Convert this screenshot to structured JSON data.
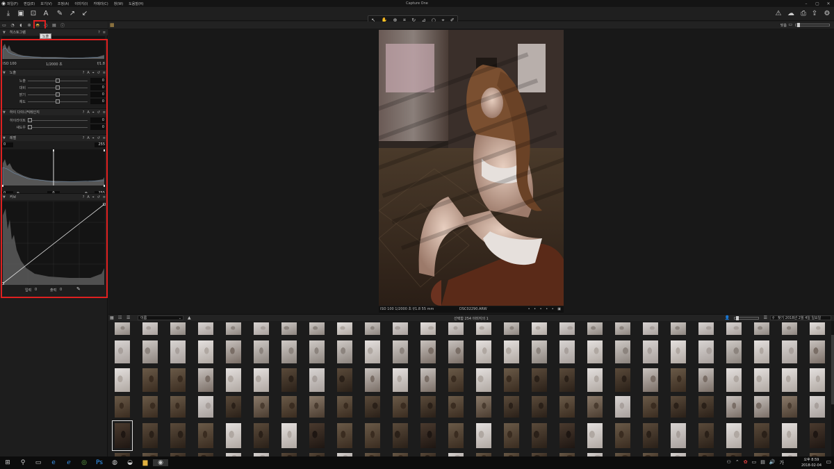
{
  "window": {
    "title": "Capture One"
  },
  "menu": [
    {
      "label": "파일(F)"
    },
    {
      "label": "편집(E)"
    },
    {
      "label": "보기(V)"
    },
    {
      "label": "조정(A)"
    },
    {
      "label": "이미지(I)"
    },
    {
      "label": "카메라(C)"
    },
    {
      "label": "창(W)"
    },
    {
      "label": "도움말(H)"
    }
  ],
  "left_tabs": {
    "tooltip": "노출"
  },
  "histogram": {
    "title": "히스토그램",
    "iso": "ISO 100",
    "shutter": "1/2000 초",
    "aperture": "f/1.8"
  },
  "exposure": {
    "title": "노출",
    "sliders": [
      {
        "label": "노출",
        "value": "0",
        "pos": 0.5
      },
      {
        "label": "대비",
        "value": "0",
        "pos": 0.5
      },
      {
        "label": "밝기",
        "value": "0",
        "pos": 0.5
      },
      {
        "label": "채도",
        "value": "0",
        "pos": 0.5
      }
    ]
  },
  "hdr": {
    "title": "하이 다이나믹레인지",
    "sliders": [
      {
        "label": "하이라이트",
        "value": "0",
        "pos": 0
      },
      {
        "label": "섀도우",
        "value": "0",
        "pos": 0
      }
    ]
  },
  "levels": {
    "title": "레벨",
    "top_left": "0",
    "top_right": "255",
    "bottom_left": "0",
    "bottom_mid": "0",
    "bottom_right": "255"
  },
  "curve": {
    "title": "커브",
    "input_label": "입력",
    "input_value": "0",
    "output_label": "출력",
    "output_value": "0"
  },
  "viewer": {
    "zoom_label": "맞춤",
    "caption_info": "ISO 100  1/2000 초  f/1.8  55 mm",
    "filename": "DSC02290.ARW"
  },
  "browser": {
    "sort_value": "이름",
    "status": "선택함 254 이미지의 1",
    "search_value": "찾기 2018년 2월 4일 일요일"
  },
  "taskbar": {
    "time": "오후 8:59",
    "date": "2018-02-04"
  }
}
